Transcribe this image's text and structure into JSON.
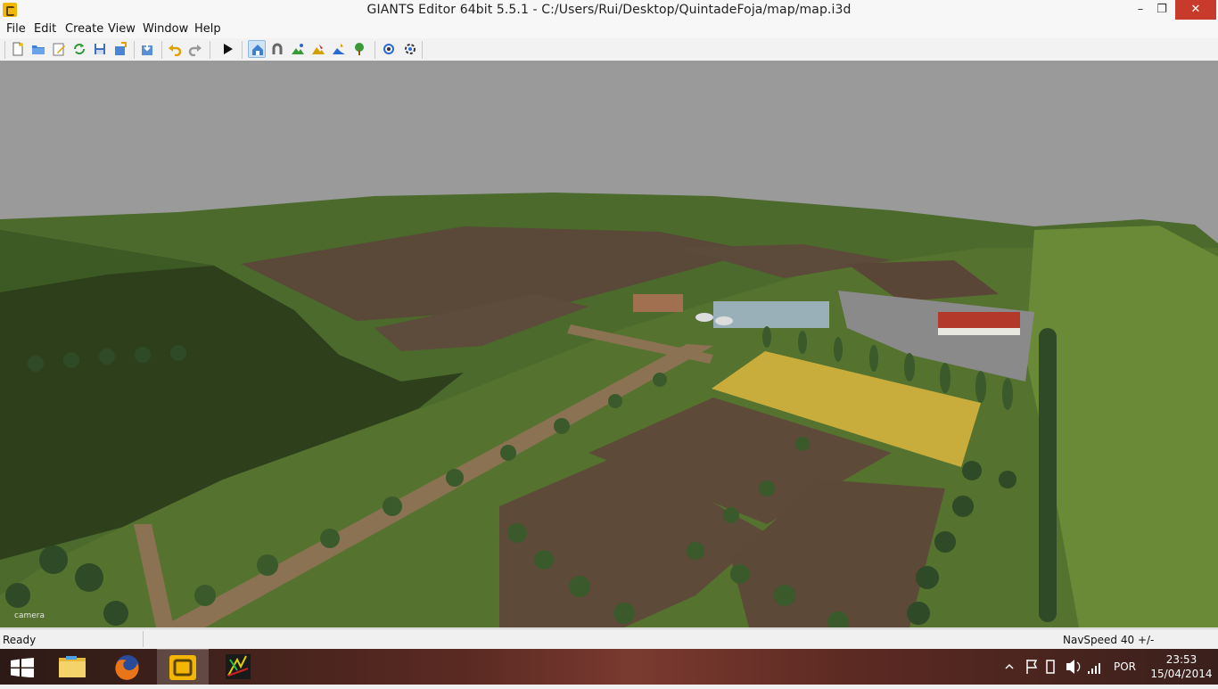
{
  "window": {
    "title": "GIANTS Editor 64bit 5.5.1 - C:/Users/Rui/Desktop/QuintadeFoja/map/map.i3d",
    "controls": {
      "minimize": "–",
      "maximize": "❐",
      "close": "✕"
    }
  },
  "menu": {
    "items": [
      "File",
      "Edit",
      "Create",
      "View",
      "Window",
      "Help"
    ]
  },
  "toolbar": {
    "icons": [
      "new-file-icon",
      "open-folder-icon",
      "edit-icon",
      "refresh-icon",
      "save-icon",
      "export-icon",
      "import-icon",
      "undo-icon",
      "redo-icon",
      "play-icon",
      "select-mode-icon",
      "magnet-icon",
      "terrain-paint-icon",
      "terrain-sculpt-icon",
      "foliage-paint-icon",
      "plant-icon",
      "rotate-camera-icon",
      "settings-camera-icon"
    ]
  },
  "viewport": {
    "camera_label": "camera",
    "sky_color": "#9a9a9a",
    "grass_color": "#4f6a31",
    "soil_color": "#5e4a38",
    "wheat_color": "#c9ad3c"
  },
  "status": {
    "left": "Ready",
    "right": "NavSpeed 40 +/-"
  },
  "taskbar": {
    "apps": [
      "file-explorer-icon",
      "firefox-icon",
      "giants-editor-icon",
      "app-icon"
    ],
    "tray": {
      "language": "POR",
      "time": "23:53",
      "date": "15/04/2014"
    }
  }
}
